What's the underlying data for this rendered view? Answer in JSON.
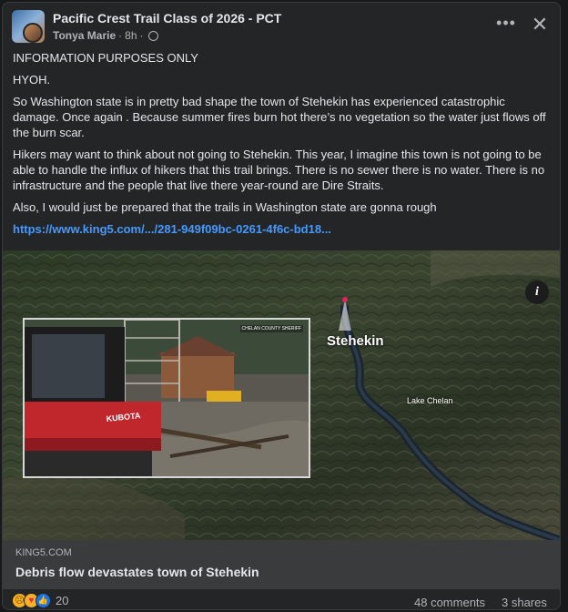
{
  "post": {
    "group_name": "Pacific Crest Trail Class of 2026 - PCT",
    "author": "Tonya Marie",
    "time": "8h",
    "separator": "·",
    "more_label": "•••",
    "close_label": "✕",
    "paragraphs": [
      "INFORMATION PURPOSES ONLY",
      "HYOH.",
      "So Washington state is in pretty bad shape the town of Stehekin has experienced catastrophic damage. Once again . Because summer fires burn hot there’s no vegetation so the water just flows off the burn scar.",
      "Hikers may want to think about not going to Stehekin. This year, I imagine this town is not going to be able to handle the influx of hikers that this trail brings. There is no sewer there is no water. There is no infrastructure and the people that live there year-round are Dire Straits.",
      "Also, I would just be prepared that the trails in Washington state are gonna rough"
    ],
    "link_text": "https://www.king5.com/.../281-949f09bc-0261-4f6c-bd18..."
  },
  "media": {
    "photo_credit": "CHELAN COUNTY SHERIFF",
    "map_label_town": "Stehekin",
    "map_label_lake": "Lake Chelan",
    "info_icon": "i",
    "pin_color": "#e0245e"
  },
  "preview": {
    "source": "KING5.COM",
    "headline": "Debris flow devastates town of Stehekin"
  },
  "footer": {
    "reactions": [
      "sad-icon",
      "care-icon",
      "like-icon"
    ],
    "reaction_count": "20",
    "comments": "48 comments",
    "shares": "3 shares"
  },
  "colors": {
    "background": "#18191a",
    "card": "#242526",
    "link": "#4599ff",
    "secondary_text": "#b0b3b8"
  }
}
